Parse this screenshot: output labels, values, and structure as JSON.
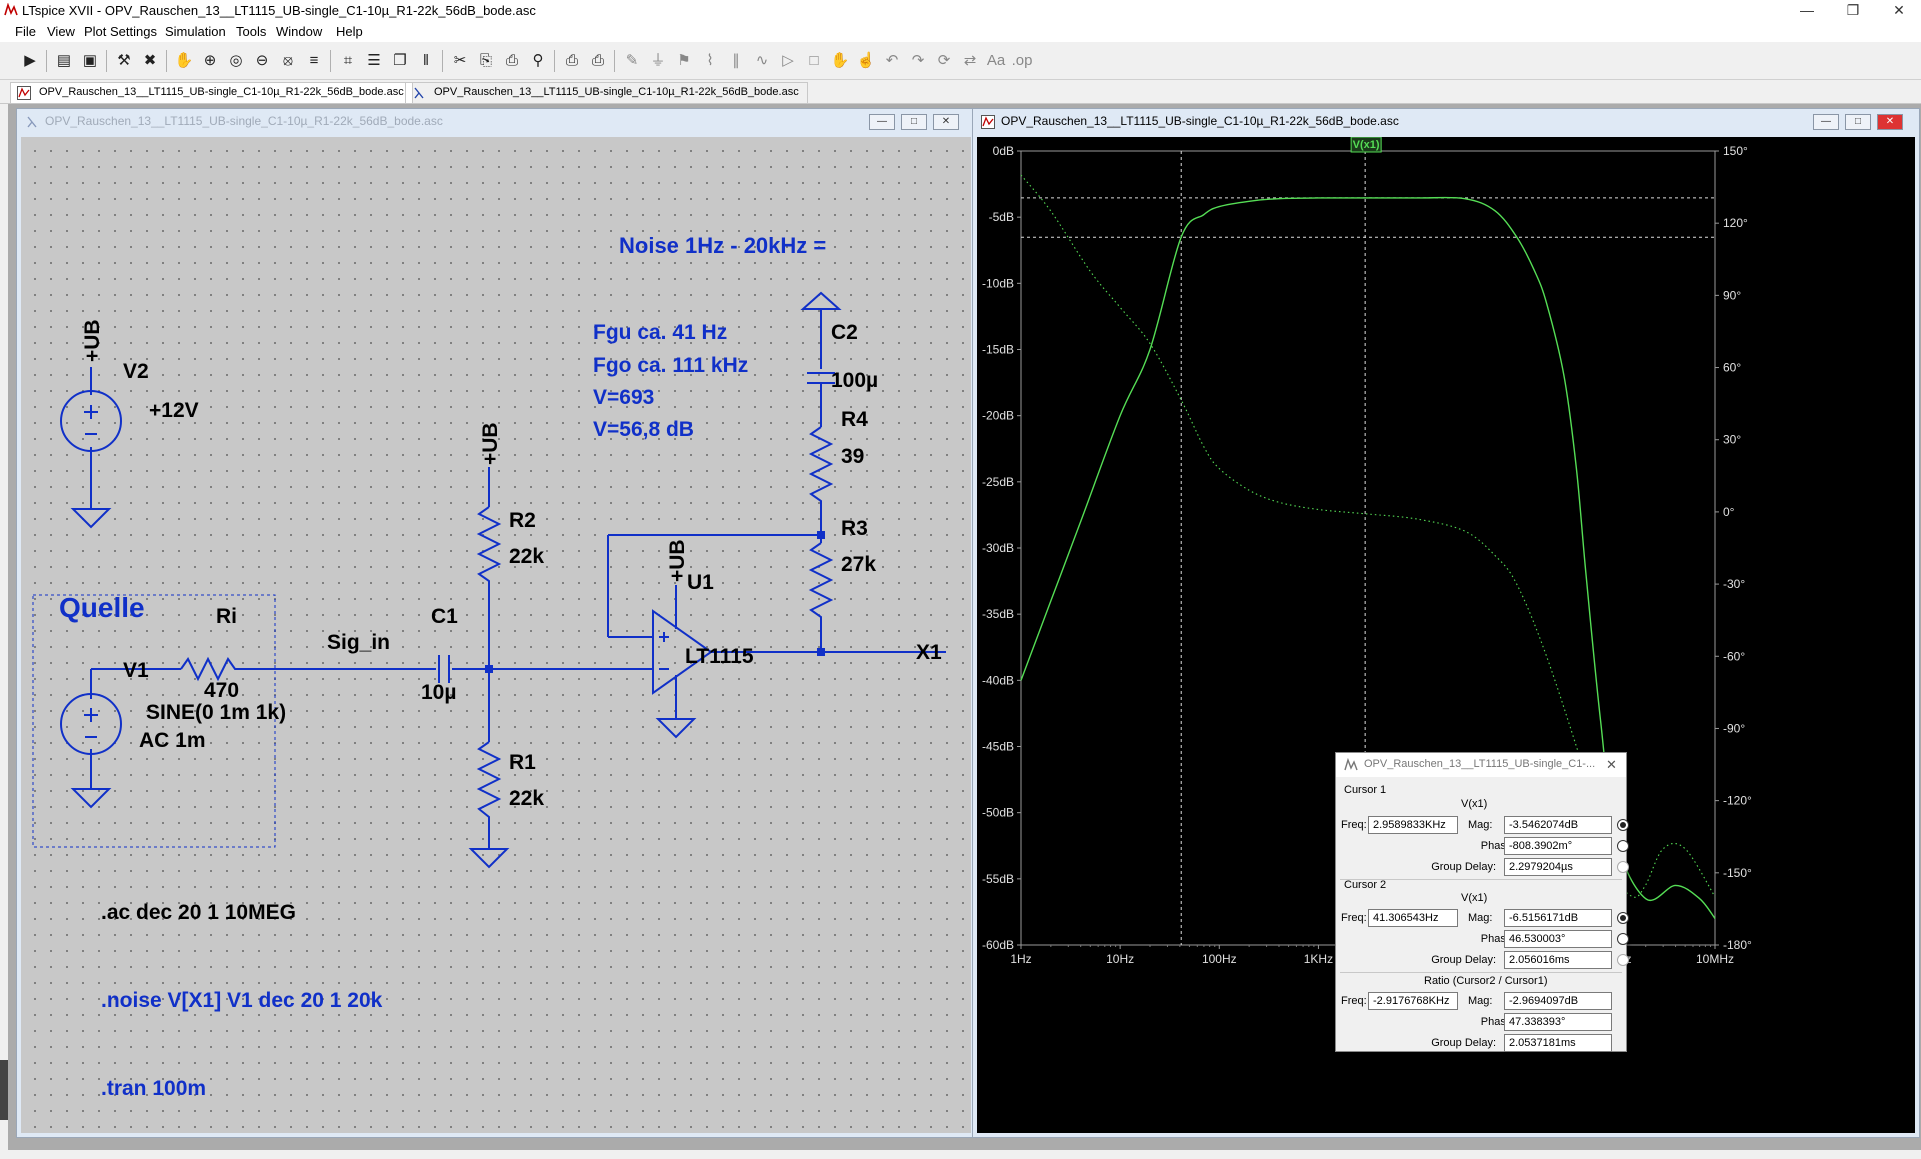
{
  "window": {
    "title": "LTspice XVII - OPV_Rauschen_13__LT1115_UB-single_C1-10µ_R1-22k_56dB_bode.asc",
    "minimize": "—",
    "restore": "❐",
    "close": "✕"
  },
  "menu": [
    "File",
    "View",
    "Plot Settings",
    "Simulation",
    "Tools",
    "Window",
    "Help"
  ],
  "toolbar": {
    "icons": [
      "run-icon",
      "open-icon",
      "save-icon",
      "control-panel-icon",
      "halt-icon",
      "pan-icon",
      "zoom-in-icon",
      "zoom-area-icon",
      "zoom-out-icon",
      "zoom-fit-icon",
      "autorange-icon",
      "grid-icon",
      "tile-horizontal-icon",
      "cascade-icon",
      "tile-vertical-icon",
      "cut-icon",
      "copy-icon",
      "paste-icon",
      "find-icon",
      "print-icon",
      "print-setup-icon",
      "draw-wire-icon",
      "ground-icon",
      "label-net-icon",
      "resistor-icon",
      "capacitor-icon",
      "inductor-icon",
      "diode-icon",
      "component-icon",
      "move-icon",
      "drag-icon",
      "undo-icon",
      "redo-icon",
      "rotate-icon",
      "mirror-icon",
      "text-icon",
      "spice-directive-icon"
    ]
  },
  "tabs": [
    {
      "label": "OPV_Rauschen_13__LT1115_UB-single_C1-10µ_R1-22k_56dB_bode.asc",
      "icon": "waveform-tab-icon"
    },
    {
      "label": "OPV_Rauschen_13__LT1115_UB-single_C1-10µ_R1-22k_56dB_bode.asc",
      "icon": "schematic-tab-icon"
    }
  ],
  "schematic": {
    "title": "OPV_Rauschen_13__LT1115_UB-single_C1-10µ_R1-22k_56dB_bode.asc",
    "labels": {
      "noise_title": "Noise 1Hz - 20kHz =",
      "fgu": "Fgu ca. 41 Hz",
      "fgo": "Fgo ca. 111 kHz",
      "v_lin": "V=693",
      "v_db": "V=56,8 dB",
      "quelle": "Quelle",
      "ri": "Ri",
      "ri_val": "470",
      "sig_in": "Sig_in",
      "c1": "C1",
      "c1_val": "10µ",
      "c2": "C2",
      "c2_val": "100µ",
      "r1": "R1",
      "r1_val": "22k",
      "r2": "R2",
      "r2_val": "22k",
      "r3": "R3",
      "r3_val": "27k",
      "r4": "R4",
      "r4_val": "39",
      "u1": "U1",
      "u1_val": "LT1115",
      "v1": "V1",
      "v1_val": "SINE(0 1m 1k)",
      "v1_ac": "AC 1m",
      "v2": "V2",
      "v2_val": "+12V",
      "ub": "+UB",
      "x1": "X1",
      "dir_ac": ".ac dec 20 1 10MEG",
      "dir_noise": ".noise V[X1] V1 dec 20 1 20k",
      "dir_tran": ".tran 100m"
    }
  },
  "plot": {
    "title": "OPV_Rauschen_13__LT1115_UB-single_C1-10µ_R1-22k_56dB_bode.asc",
    "trace_label": "V(x1)",
    "colors": {
      "trace": "#55dd55",
      "axis_text": "#e0e0e0",
      "grid": "#ffffff"
    }
  },
  "chart_data": {
    "type": "line",
    "title": "",
    "x_scale": "log",
    "xlim": [
      1,
      10000000
    ],
    "x_ticks": [
      "1Hz",
      "10Hz",
      "100Hz",
      "1KHz",
      "10KHz",
      "100KHz",
      "1MHz",
      "10MHz"
    ],
    "ylim_left": [
      -60,
      0
    ],
    "y_ticks_left": [
      "0dB",
      "-5dB",
      "-10dB",
      "-15dB",
      "-20dB",
      "-25dB",
      "-30dB",
      "-35dB",
      "-40dB",
      "-45dB",
      "-50dB",
      "-55dB",
      "-60dB"
    ],
    "ylim_right": [
      -180,
      150
    ],
    "y_ticks_right": [
      "150°",
      "120°",
      "90°",
      "60°",
      "30°",
      "0°",
      "-30°",
      "-60°",
      "-90°",
      "-120°",
      "-150°",
      "-180°"
    ],
    "series": [
      {
        "name": "V(x1)",
        "axis": "left",
        "style": "solid",
        "x": [
          1,
          2,
          4,
          10,
          20,
          41.3,
          70,
          100,
          200,
          400,
          1000,
          3000,
          10000,
          30000,
          60000,
          100000,
          150000,
          200000,
          300000,
          400000,
          500000,
          700000,
          1000000,
          2000000,
          4000000,
          7000000,
          10000000
        ],
        "y": [
          -40,
          -34,
          -28,
          -20,
          -15,
          -6.5,
          -4.8,
          -4.2,
          -3.8,
          -3.6,
          -3.55,
          -3.55,
          -3.55,
          -3.6,
          -4.5,
          -6.5,
          -9,
          -11.5,
          -17,
          -24,
          -32,
          -43,
          -52,
          -56.5,
          -55.5,
          -56.5,
          -58
        ]
      },
      {
        "name": "phase",
        "axis": "right",
        "style": "dotted",
        "x": [
          1,
          2,
          5,
          10,
          20,
          41.3,
          70,
          100,
          200,
          400,
          1000,
          3000,
          10000,
          30000,
          60000,
          100000,
          200000,
          500000,
          1000000,
          1500000,
          2000000,
          3000000,
          5000000,
          10000000
        ],
        "y": [
          140,
          125,
          100,
          85,
          70,
          46.5,
          27,
          18,
          9,
          4,
          1,
          -0.8,
          -3,
          -8,
          -18,
          -30,
          -60,
          -110,
          -150,
          -160,
          -155,
          -140,
          -140,
          -160
        ]
      }
    ],
    "cursor1_x": 2958.9833,
    "cursor1_y": -3.5462074,
    "cursor2_x": 41.306543,
    "cursor2_y": -6.5156171
  },
  "cursor_dialog": {
    "title": "OPV_Rauschen_13__LT1115_UB-single_C1-...",
    "c1_header": "Cursor 1",
    "c1_trace": "V(x1)",
    "c1_freq": "2.9589833KHz",
    "c1_mag": "-3.5462074dB",
    "c1_phase": "-808.3902m°",
    "c1_gd": "2.2979204µs",
    "c2_header": "Cursor 2",
    "c2_trace": "V(x1)",
    "c2_freq": "41.306543Hz",
    "c2_mag": "-6.5156171dB",
    "c2_phase": "46.530003°",
    "c2_gd": "2.056016ms",
    "ratio_header": "Ratio (Cursor2 / Cursor1)",
    "r_freq": "-2.9176768KHz",
    "r_mag": "-2.9694097dB",
    "r_phase": "47.338393°",
    "r_gd": "2.0537181ms",
    "freq_lbl": "Freq:",
    "mag_lbl": "Mag:",
    "phase_lbl": "Phase:",
    "gd_lbl": "Group Delay:"
  }
}
